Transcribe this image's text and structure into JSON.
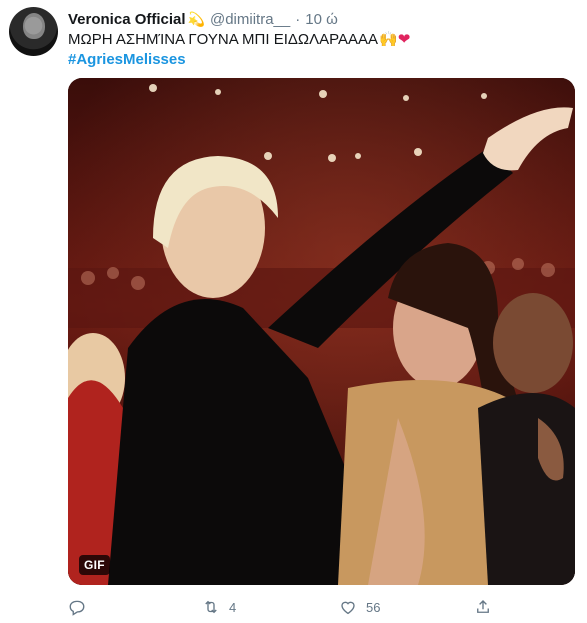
{
  "tweet": {
    "author": {
      "name": "Veronica Official",
      "name_emoji": "💫",
      "handle": "@dimiitra__",
      "separator": "·",
      "time": "10 ώ"
    },
    "text": "ΜΩΡΗ ΑΣΗΜΊΝΑ ΓΟΥΝΑ ΜΠΙ ΕΙΔΩΛΑΡΑΑΑΑ",
    "text_emoji_hands": "🙌",
    "text_emoji_heart": "❤",
    "hashtag": "#AgriesMelisses",
    "media": {
      "badge": "GIF"
    },
    "stats": {
      "retweets": "4",
      "likes": "56"
    }
  },
  "icons": [
    "reply-icon",
    "retweet-icon",
    "like-icon",
    "share-icon"
  ]
}
